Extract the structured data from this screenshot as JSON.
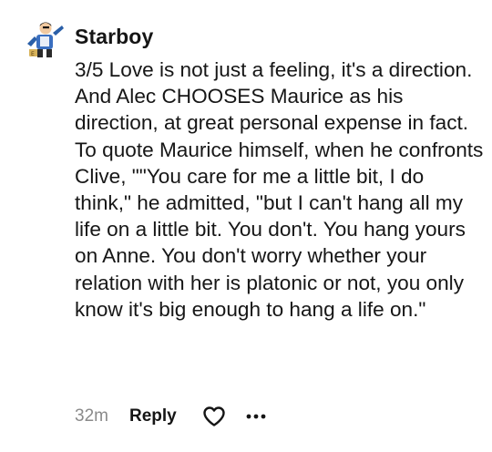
{
  "comment": {
    "username": "Starboy",
    "avatar_icon": "cartoon-character-avatar",
    "body": "3/5 Love is not just a feeling, it's a direction. And Alec CHOOSES Maurice as his direction, at great personal expense in fact. To quote Maurice himself, when he confronts Clive, \"\"You care for me a little bit, I do think,\" he admitted, \"but I can't hang all my life on a little bit. You don't. You hang yours on Anne. You don't worry whether your relation with her is platonic or not, you only know it's big enough to hang a life on.\"",
    "timestamp": "32m",
    "reply_label": "Reply",
    "like_icon": "heart-outline-icon",
    "more_icon": "ellipsis-icon"
  },
  "colors": {
    "text": "#161616",
    "muted": "#8a8a8a",
    "background": "#ffffff"
  }
}
